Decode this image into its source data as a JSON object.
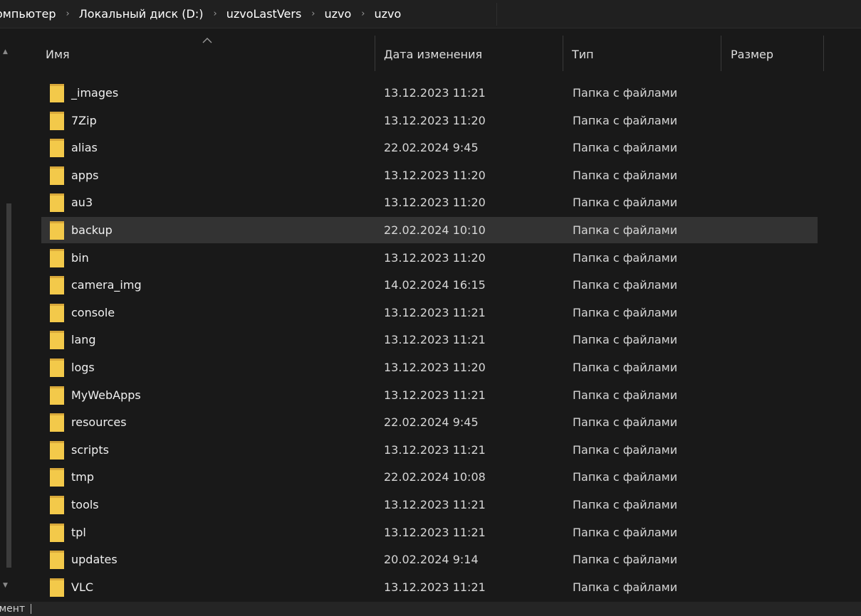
{
  "breadcrumb": {
    "items": [
      "омпьютер",
      "Локальный диск (D:)",
      "uzvoLastVers",
      "uzvo",
      "uzvo"
    ],
    "separator": "›"
  },
  "columns": {
    "name": "Имя",
    "date": "Дата изменения",
    "type": "Тип",
    "size": "Размер"
  },
  "sort": {
    "column": "name",
    "icon": "sort-ascending-chevron"
  },
  "folder_color": "#f3c94a",
  "selected_row": "backup",
  "files": [
    {
      "name": "_images",
      "date": "13.12.2023 11:21",
      "type": "Папка с файлами"
    },
    {
      "name": "7Zip",
      "date": "13.12.2023 11:20",
      "type": "Папка с файлами"
    },
    {
      "name": "alias",
      "date": "22.02.2024 9:45",
      "type": "Папка с файлами"
    },
    {
      "name": "apps",
      "date": "13.12.2023 11:20",
      "type": "Папка с файлами"
    },
    {
      "name": "au3",
      "date": "13.12.2023 11:20",
      "type": "Папка с файлами"
    },
    {
      "name": "backup",
      "date": "22.02.2024 10:10",
      "type": "Папка с файлами"
    },
    {
      "name": "bin",
      "date": "13.12.2023 11:20",
      "type": "Папка с файлами"
    },
    {
      "name": "camera_img",
      "date": "14.02.2024 16:15",
      "type": "Папка с файлами"
    },
    {
      "name": "console",
      "date": "13.12.2023 11:21",
      "type": "Папка с файлами"
    },
    {
      "name": "lang",
      "date": "13.12.2023 11:21",
      "type": "Папка с файлами"
    },
    {
      "name": "logs",
      "date": "13.12.2023 11:20",
      "type": "Папка с файлами"
    },
    {
      "name": "MyWebApps",
      "date": "13.12.2023 11:21",
      "type": "Папка с файлами"
    },
    {
      "name": "resources",
      "date": "22.02.2024 9:45",
      "type": "Папка с файлами"
    },
    {
      "name": "scripts",
      "date": "13.12.2023 11:21",
      "type": "Папка с файлами"
    },
    {
      "name": "tmp",
      "date": "22.02.2024 10:08",
      "type": "Папка с файлами"
    },
    {
      "name": "tools",
      "date": "13.12.2023 11:21",
      "type": "Папка с файлами"
    },
    {
      "name": "tpl",
      "date": "13.12.2023 11:21",
      "type": "Папка с файлами"
    },
    {
      "name": "updates",
      "date": "20.02.2024 9:14",
      "type": "Папка с файлами"
    },
    {
      "name": "VLC",
      "date": "13.12.2023 11:21",
      "type": "Папка с файлами"
    }
  ],
  "status": {
    "text": "емент"
  }
}
